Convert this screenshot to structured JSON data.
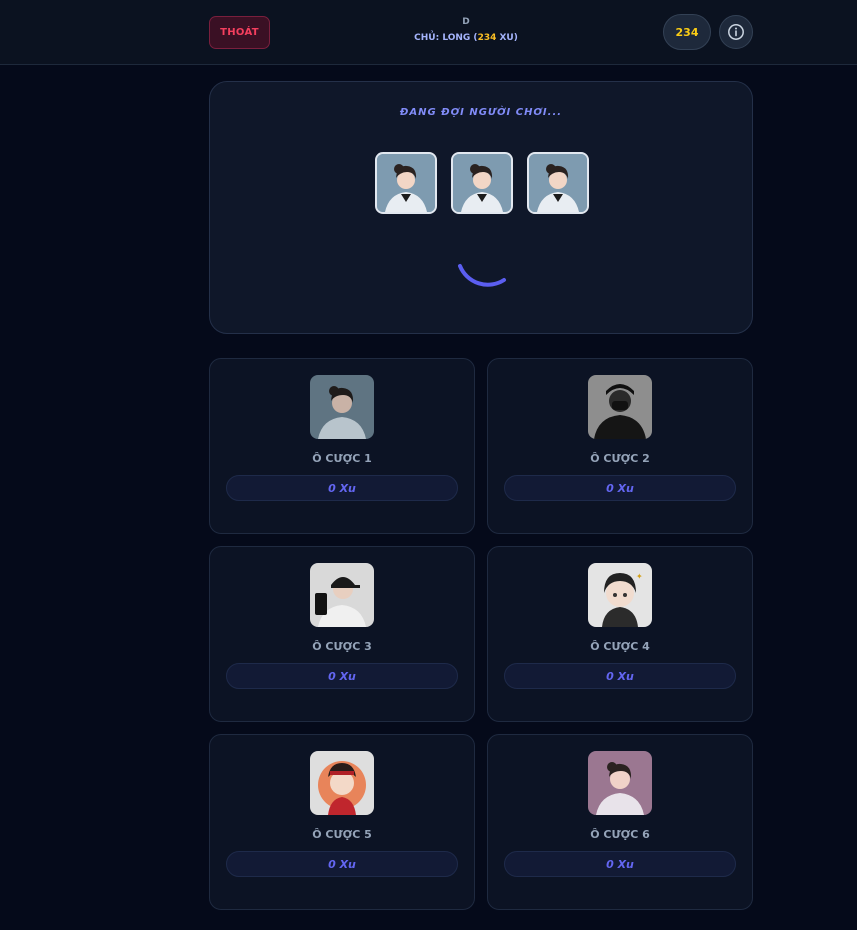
{
  "header": {
    "exit_label": "THOÁT",
    "room_id": "D",
    "host_prefix": "CHỦ: LONG (",
    "host_coins": "234",
    "host_suffix": " XU)",
    "balance": "234",
    "info_icon": "info-icon"
  },
  "waiting": {
    "title": "ĐANG ĐỢI NGƯỜI CHƠI...",
    "slot_count": 3,
    "spinner_icon": "loading-spinner-icon"
  },
  "cells": [
    {
      "label": "Ô CƯỢC 1",
      "bet": "0 Xu"
    },
    {
      "label": "Ô CƯỢC 2",
      "bet": "0 Xu"
    },
    {
      "label": "Ô CƯỢC 3",
      "bet": "0 Xu"
    },
    {
      "label": "Ô CƯỢC 4",
      "bet": "0 Xu"
    },
    {
      "label": "Ô CƯỢC 5",
      "bet": "0 Xu"
    },
    {
      "label": "Ô CƯỢC 6",
      "bet": "0 Xu"
    }
  ],
  "colors": {
    "accent": "#6366f1",
    "coin": "#facc15",
    "danger": "#f43f5e"
  }
}
